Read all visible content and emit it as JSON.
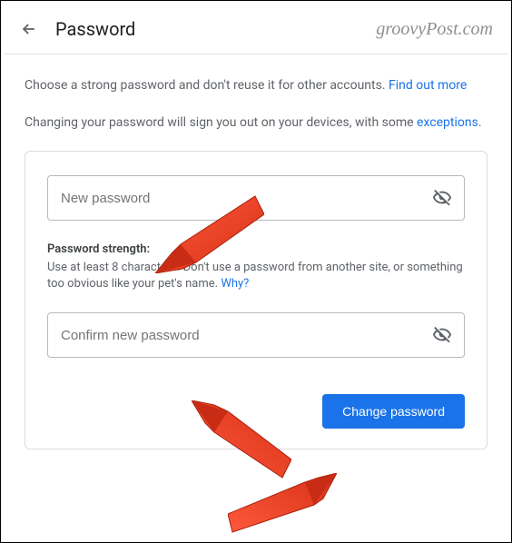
{
  "header": {
    "title": "Password",
    "watermark": "groovyPost.com"
  },
  "intro": {
    "p1_prefix": "Choose a strong password and don't reuse it for other accounts. ",
    "p1_link": "Find out more",
    "p2_prefix": "Changing your password will sign you out on your devices, with some ",
    "p2_link": "exceptions",
    "p2_suffix": "."
  },
  "form": {
    "new_password_placeholder": "New password",
    "confirm_password_placeholder": "Confirm new password",
    "strength_label": "Password strength:",
    "strength_note_prefix": "Use at least 8 characters. Don't use a password from another site, or something too obvious like your pet's name. ",
    "strength_note_link": "Why?",
    "change_button": "Change password"
  }
}
